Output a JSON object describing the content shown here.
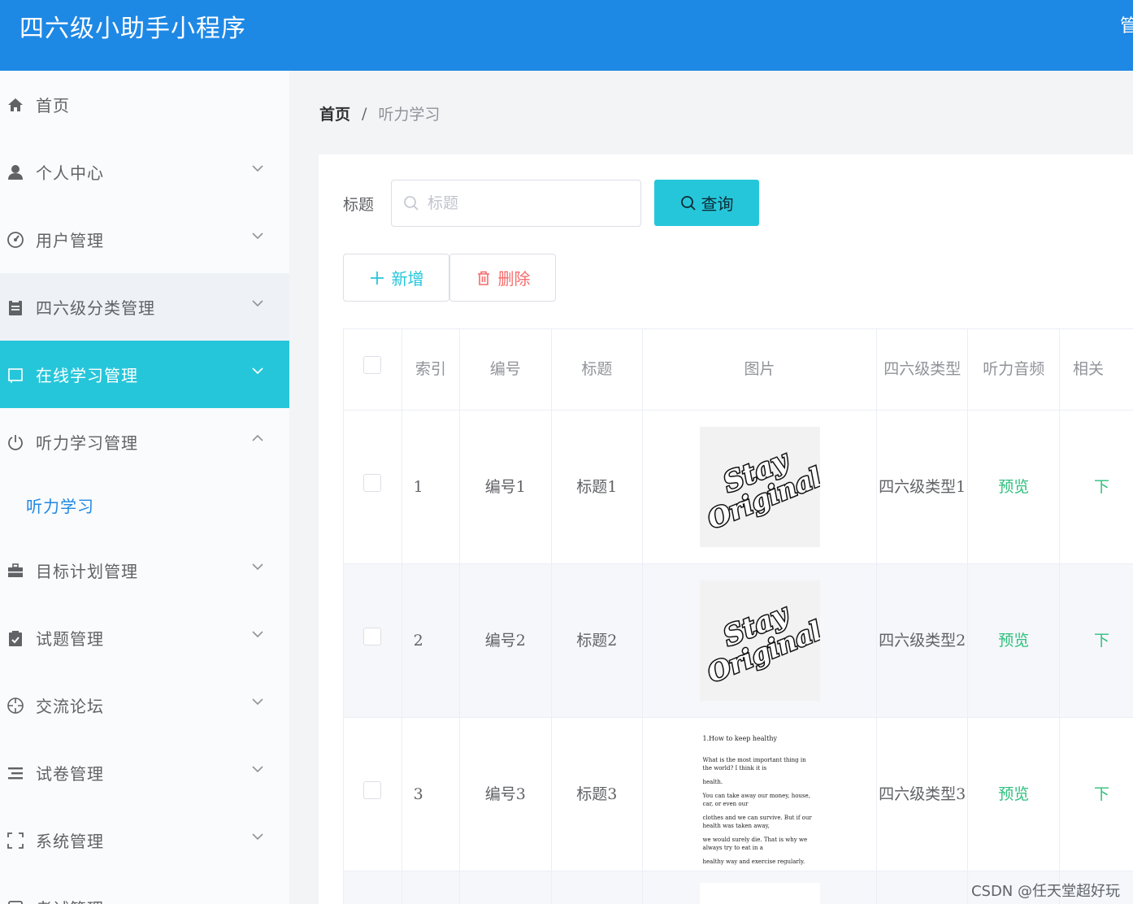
{
  "app": {
    "title": "四六级小助手小程序",
    "top_right_glyph": "管"
  },
  "sidebar": {
    "items": [
      {
        "label": "首页",
        "icon": "home-icon"
      },
      {
        "label": "个人中心",
        "icon": "user-icon"
      },
      {
        "label": "用户管理",
        "icon": "dashboard-icon"
      },
      {
        "label": "四六级分类管理",
        "icon": "clipboard-icon"
      },
      {
        "label": "在线学习管理",
        "icon": "book-icon"
      },
      {
        "label": "听力学习管理",
        "icon": "power-icon"
      },
      {
        "label": "目标计划管理",
        "icon": "briefcase-icon"
      },
      {
        "label": "试题管理",
        "icon": "checklist-icon"
      },
      {
        "label": "交流论坛",
        "icon": "crosshair-icon"
      },
      {
        "label": "试卷管理",
        "icon": "list-icon"
      },
      {
        "label": "系统管理",
        "icon": "fullscreen-icon"
      },
      {
        "label": "考试管理",
        "icon": "exam-icon"
      }
    ],
    "active_item": "在线学习管理",
    "expanded_item": "听力学习管理",
    "submenu": [
      {
        "label": "听力学习"
      }
    ]
  },
  "breadcrumb": {
    "home": "首页",
    "separator": "/",
    "current": "听力学习"
  },
  "search": {
    "label": "标题",
    "placeholder": "标题",
    "value": "",
    "button_label": "查询"
  },
  "actions": {
    "add_label": "新增",
    "delete_label": "删除"
  },
  "table": {
    "columns": [
      "索引",
      "编号",
      "标题",
      "图片",
      "四六级类型",
      "听力音频",
      "相关"
    ],
    "rows": [
      {
        "index": "1",
        "code": "编号1",
        "title": "标题1",
        "image": "stay-original-logo",
        "type": "四六级类型1",
        "audio": "预览",
        "related": "下"
      },
      {
        "index": "2",
        "code": "编号2",
        "title": "标题2",
        "image": "stay-original-logo",
        "type": "四六级类型2",
        "audio": "预览",
        "related": "下"
      },
      {
        "index": "3",
        "code": "编号3",
        "title": "标题3",
        "image": "essay-document",
        "type": "四六级类型3",
        "audio": "预览",
        "related": "下"
      }
    ],
    "doc_preview": {
      "title": "1.How to keep healthy",
      "lines": [
        "What is the most important thing in the world? I think it is",
        "health.",
        "You can take away our money, house, car, or even our",
        "clothes and we can survive. But if our health was taken away,",
        "we would surely die. That is why we always try to eat in a",
        "healthy way and exercise regularly."
      ]
    },
    "logo_text": [
      "Stay",
      "Original"
    ]
  },
  "watermark": "CSDN @任天堂超好玩",
  "colors": {
    "header_blue": "#1e88e5",
    "accent_cyan": "#26c6da",
    "link_green": "#2ec07e",
    "danger_red": "#f56c6c"
  }
}
